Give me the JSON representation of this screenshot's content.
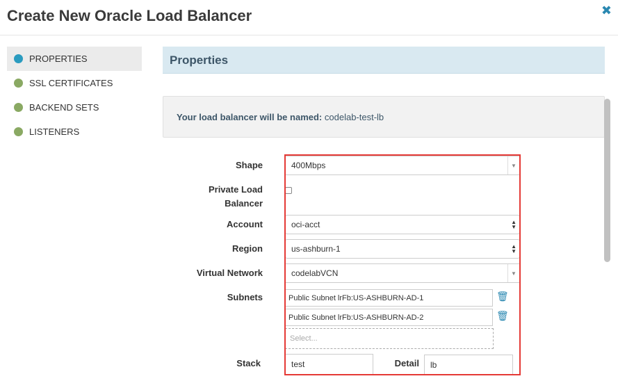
{
  "header": {
    "title": "Create New Oracle Load Balancer",
    "close_glyph": "✖"
  },
  "nav": {
    "items": [
      {
        "label": "PROPERTIES",
        "color": "#2a9bbf",
        "active": true
      },
      {
        "label": "SSL CERTIFICATES",
        "color": "#8aa963",
        "active": false
      },
      {
        "label": "BACKEND SETS",
        "color": "#8aa963",
        "active": false
      },
      {
        "label": "LISTENERS",
        "color": "#8aa963",
        "active": false
      }
    ]
  },
  "panel": {
    "title": "Properties",
    "info_label": "Your load balancer will be named:",
    "info_value": "codelab-test-lb"
  },
  "form": {
    "shape_label": "Shape",
    "shape_value": "400Mbps",
    "private_label_line1": "Private Load",
    "private_label_line2": "Balancer",
    "private_checked": false,
    "account_label": "Account",
    "account_value": "oci-acct",
    "region_label": "Region",
    "region_value": "us-ashburn-1",
    "vnet_label": "Virtual Network",
    "vnet_value": "codelabVCN",
    "subnets_label": "Subnets",
    "subnets": [
      "Public Subnet lrFb:US-ASHBURN-AD-1",
      "Public Subnet lrFb:US-ASHBURN-AD-2"
    ],
    "subnets_placeholder": "Select...",
    "stack_label": "Stack",
    "stack_value": "test",
    "detail_label": "Detail",
    "detail_value": "lb"
  },
  "icons": {
    "close": "close-icon",
    "dropdown": "caret-down-icon",
    "updown": "updown-arrows-icon",
    "trash": "trash-icon"
  },
  "colors": {
    "accent": "#2a88b1",
    "highlight_border": "#e53935",
    "panel_header_bg": "#d9e9f1"
  }
}
